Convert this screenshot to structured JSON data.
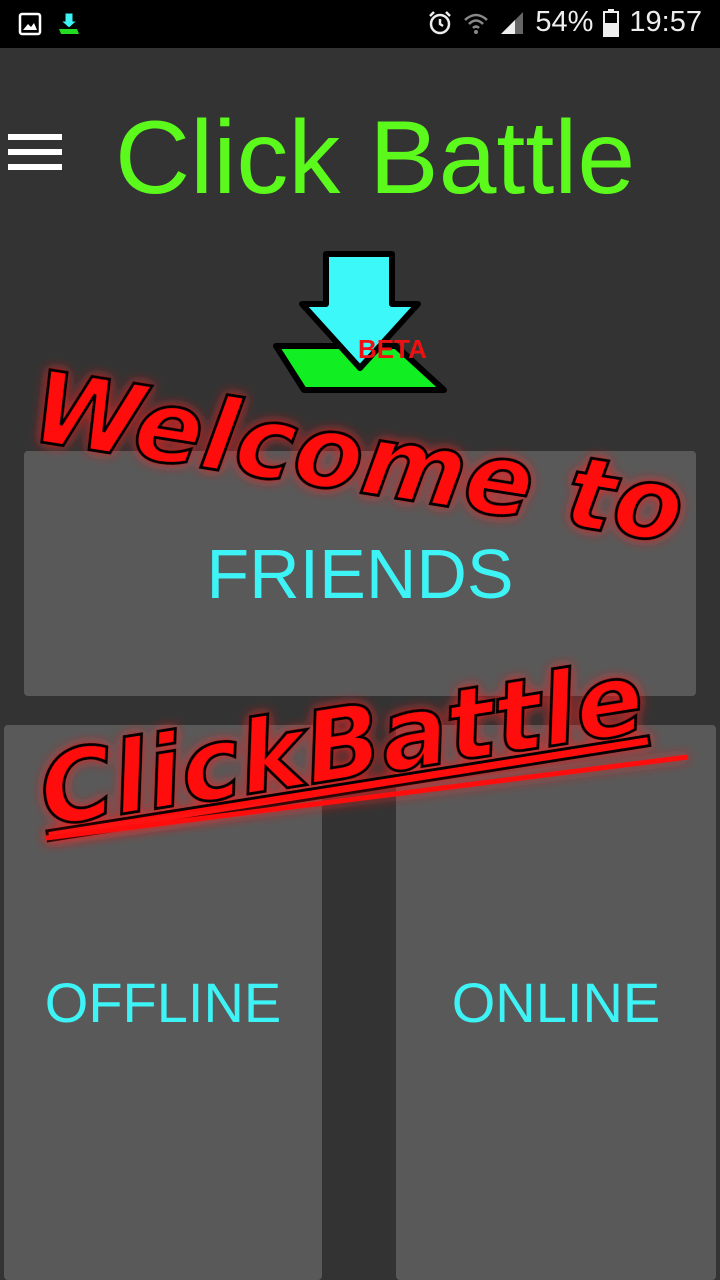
{
  "status_bar": {
    "battery": "54%",
    "time": "19:57",
    "icons": [
      "image-notification-icon",
      "download-notification-icon",
      "alarm-icon",
      "wifi-icon",
      "signal-icon",
      "battery-icon"
    ]
  },
  "header": {
    "title": "Click Battle",
    "menu_icon": "hamburger-menu-icon"
  },
  "logo": {
    "badge": "BETA"
  },
  "modes": {
    "friends": "FRIENDS",
    "offline": "OFFLINE",
    "online": "ONLINE"
  },
  "overlay": {
    "line1": "Welcome to",
    "line2": "ClickBattle"
  },
  "colors": {
    "background": "#333333",
    "button": "#595959",
    "title": "#5cfa1c",
    "button_text": "#3df3f5",
    "overlay_text": "#ff1a1a"
  }
}
